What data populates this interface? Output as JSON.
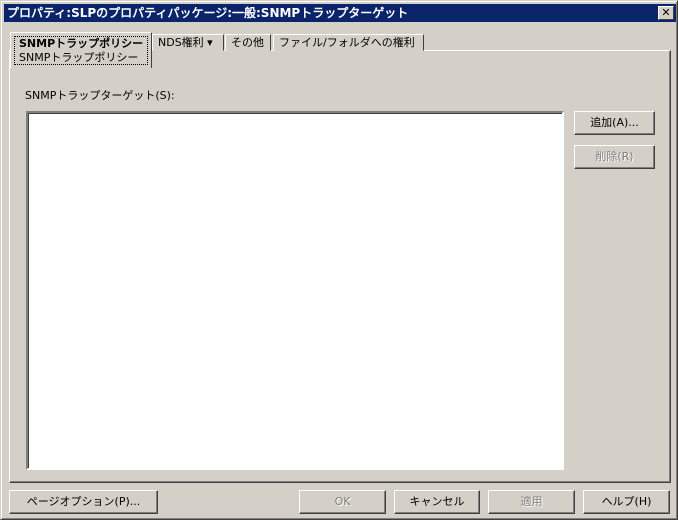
{
  "window": {
    "title": "プロパティ:SLPのプロパティパッケージ:一般:SNMPトラップターゲット",
    "close": "✕"
  },
  "tabs": [
    {
      "label": "SNMPトラップポリシー",
      "sub": "SNMPトラップポリシー",
      "active": true
    },
    {
      "label": "NDS権利 ▾"
    },
    {
      "label": "その他"
    },
    {
      "label": "ファイル/フォルダへの権利"
    }
  ],
  "main": {
    "list_label": "SNMPトラップターゲット(S):",
    "list_items": [],
    "add": "追加(A)...",
    "delete": "削除(R)"
  },
  "footer": {
    "page_options": "ページオプション(P)...",
    "ok": "OK",
    "cancel": "キャンセル",
    "apply": "適用",
    "help": "ヘルプ(H)"
  }
}
